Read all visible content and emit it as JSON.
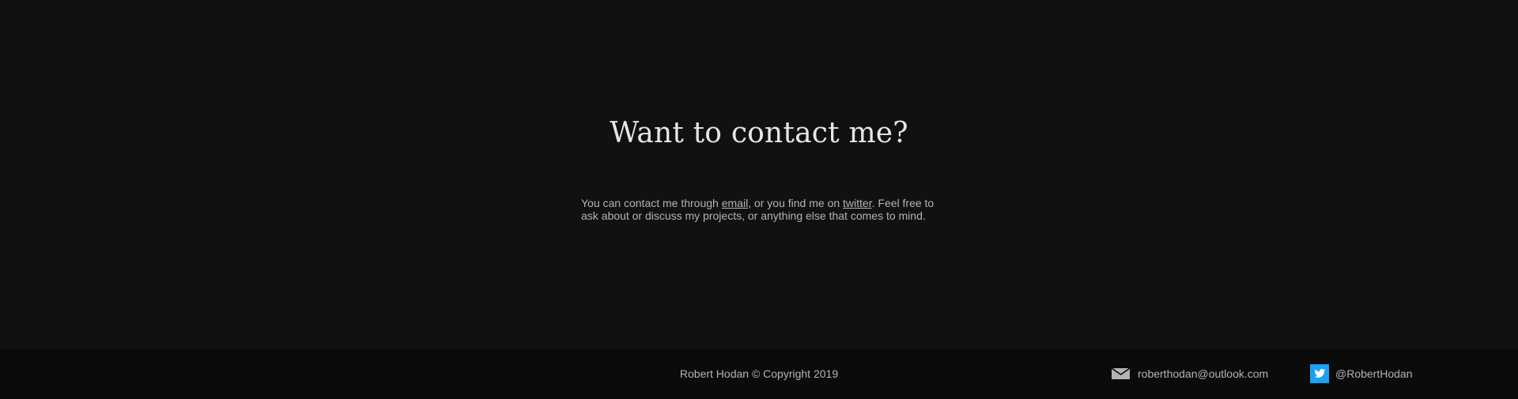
{
  "contact": {
    "title": "Want to contact me?",
    "text_before_email": "You can contact me through ",
    "email_link": "email,",
    "text_between": " or you find me on ",
    "twitter_link": "twitter",
    "text_after": ". Feel free to ask about or discuss my projects, or anything else that comes to mind."
  },
  "footer": {
    "copyright": "Robert Hodan © Copyright 2019",
    "email": "roberthodan@outlook.com",
    "twitter_handle": "@RobertHodan"
  },
  "colors": {
    "background": "#111111",
    "footer_background": "#0b0b0b",
    "heading": "#e6e6e6",
    "text": "#b4b4b4",
    "twitter_brand": "#1da1f2"
  },
  "icons": {
    "mail": "mail-icon",
    "twitter": "twitter-icon"
  }
}
